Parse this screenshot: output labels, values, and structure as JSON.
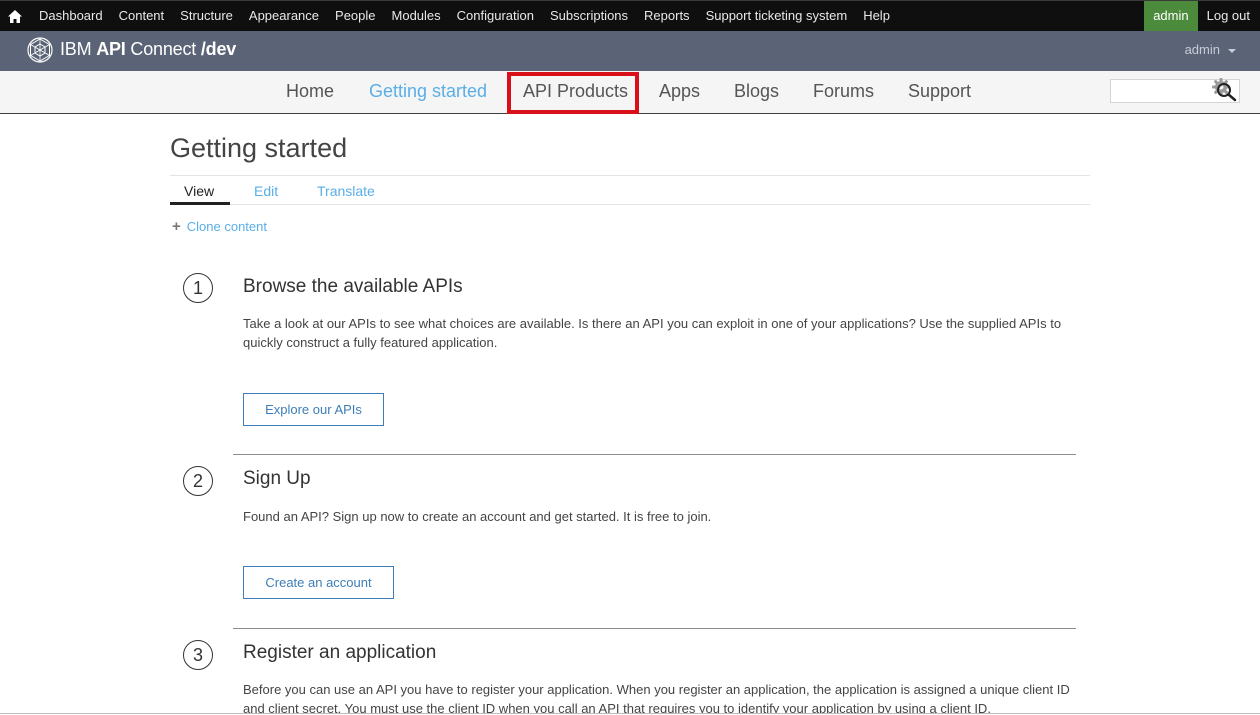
{
  "admin_toolbar": {
    "items": [
      "Dashboard",
      "Content",
      "Structure",
      "Appearance",
      "People",
      "Modules",
      "Configuration",
      "Subscriptions",
      "Reports",
      "Support ticketing system",
      "Help"
    ],
    "user": "admin",
    "logout": "Log out"
  },
  "brand": {
    "prefix": "IBM ",
    "bold": "API",
    "middle": " Connect ",
    "suffix": "/dev",
    "user_menu": "admin"
  },
  "main_nav": {
    "items": [
      "Home",
      "Getting started",
      "API Products",
      "Apps",
      "Blogs",
      "Forums",
      "Support"
    ],
    "active": "Getting started",
    "highlighted": "API Products"
  },
  "search": {
    "placeholder": "",
    "value": ""
  },
  "page": {
    "title": "Getting started",
    "tabs": [
      "View",
      "Edit",
      "Translate"
    ],
    "active_tab": "View",
    "clone_link": "Clone content"
  },
  "steps": [
    {
      "number": "1",
      "title": "Browse the available APIs",
      "body": "Take a look at our APIs to see what choices are available. Is there an API you can exploit in one of your applications? Use the supplied APIs to quickly construct a fully featured application.",
      "button": "Explore our APIs"
    },
    {
      "number": "2",
      "title": "Sign Up",
      "body": "Found an API? Sign up now to create an account and get started. It is free to join.",
      "button": "Create an account"
    },
    {
      "number": "3",
      "title": "Register an application",
      "body": "Before you can use an API you have to register your application. When you register an application, the application is assigned a unique client ID and client secret. You must use the client ID when you call an API that requires you to identify your application by using a client ID."
    }
  ],
  "colors": {
    "admin_bar": "#0f0f0f",
    "brand_bar": "#5b6376",
    "admin_user_bg": "#4b8b3b",
    "accent_link": "#5aaee7",
    "button_border": "#3d7eb8",
    "highlight": "#d9101a"
  }
}
